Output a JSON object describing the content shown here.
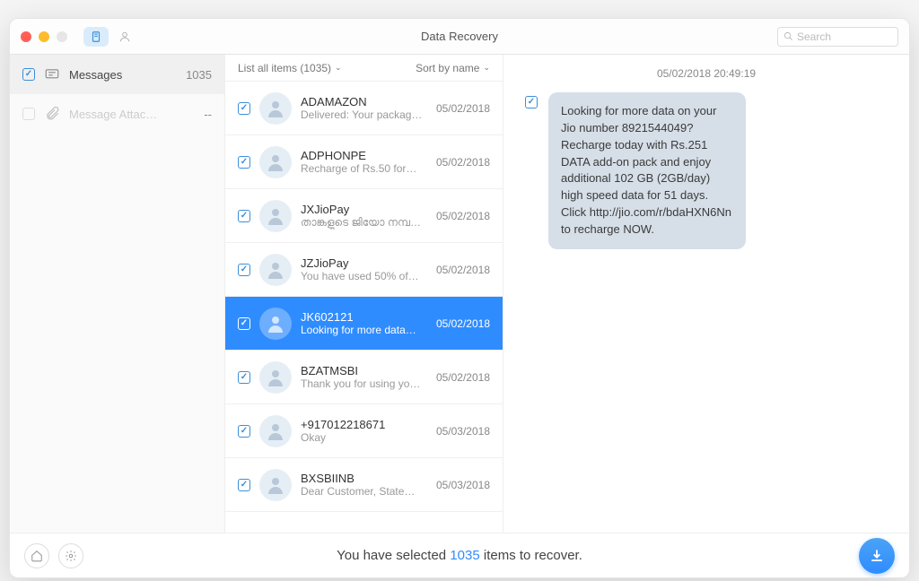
{
  "window": {
    "title": "Data Recovery"
  },
  "search": {
    "placeholder": "Search"
  },
  "sidebar": {
    "items": [
      {
        "label": "Messages",
        "count": "1035",
        "checked": true
      },
      {
        "label": "Message Attac…",
        "count": "--",
        "checked": false
      }
    ]
  },
  "listHeader": {
    "filter": "List all items (1035)",
    "sort": "Sort by name"
  },
  "threads": [
    {
      "name": "ADAMAZON",
      "preview": "Delivered: Your packag…",
      "date": "05/02/2018",
      "selected": false
    },
    {
      "name": "ADPHONPE",
      "preview": "Recharge of Rs.50 for…",
      "date": "05/02/2018",
      "selected": false
    },
    {
      "name": "JXJioPay",
      "preview": "താങ്കളുടെ ജിയോ നമ്പറി…",
      "date": "05/02/2018",
      "selected": false
    },
    {
      "name": "JZJioPay",
      "preview": "You have used 50% of…",
      "date": "05/02/2018",
      "selected": false
    },
    {
      "name": "JK602121",
      "preview": "Looking for more data…",
      "date": "05/02/2018",
      "selected": true
    },
    {
      "name": "BZATMSBI",
      "preview": "Thank you for using yo…",
      "date": "05/02/2018",
      "selected": false
    },
    {
      "name": "+917012218671",
      "preview": "Okay",
      "date": "05/03/2018",
      "selected": false
    },
    {
      "name": "BXSBIINB",
      "preview": "Dear Customer, State…",
      "date": "05/03/2018",
      "selected": false
    }
  ],
  "detail": {
    "timestamp": "05/02/2018 20:49:19",
    "message": "Looking for more data on your Jio number 8921544049? Recharge today with Rs.251 DATA add-on pack and enjoy additional 102 GB (2GB/day) high speed data for 51 days. Click http://jio.com/r/bdaHXN6Nn to recharge NOW."
  },
  "footer": {
    "prefix": "You have selected ",
    "count": "1035",
    "suffix": " items to recover."
  }
}
